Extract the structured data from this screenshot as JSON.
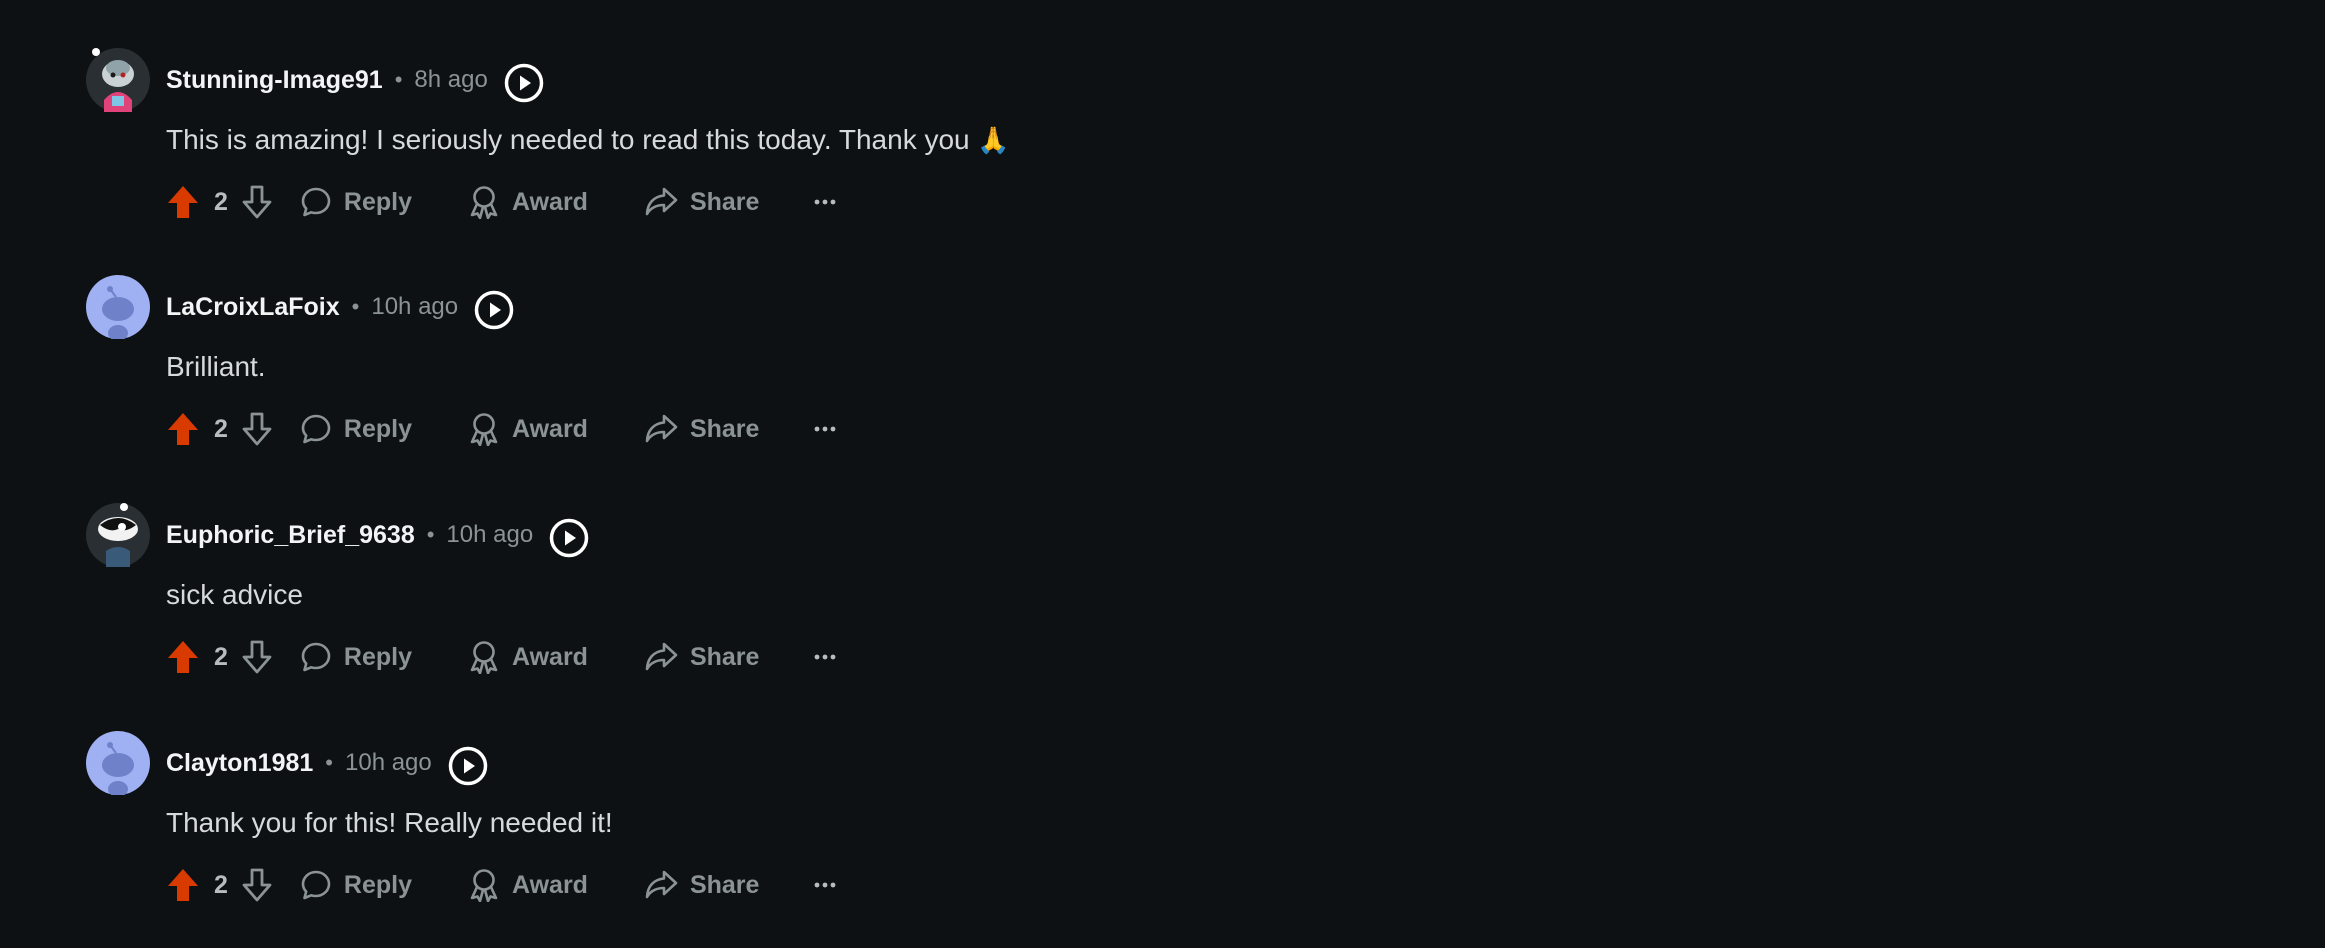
{
  "comments": [
    {
      "username": "Stunning-Image91",
      "separator": "•",
      "time": "8h ago",
      "text": "This is amazing! I seriously needed to read this today. Thank you",
      "emoji": "🙏",
      "score": "2",
      "reply_label": "Reply",
      "award_label": "Award",
      "share_label": "Share",
      "avatar_icon": "snoo-avatar-custom"
    },
    {
      "username": "LaCroixLaFoix",
      "separator": "•",
      "time": "10h ago",
      "text": "Brilliant.",
      "score": "2",
      "reply_label": "Reply",
      "award_label": "Award",
      "share_label": "Share",
      "avatar_icon": "snoo-avatar-default"
    },
    {
      "username": "Euphoric_Brief_9638",
      "separator": "•",
      "time": "10h ago",
      "text": "sick advice",
      "score": "2",
      "reply_label": "Reply",
      "award_label": "Award",
      "share_label": "Share",
      "avatar_icon": "snoo-avatar-custom"
    },
    {
      "username": "Clayton1981",
      "separator": "•",
      "time": "10h ago",
      "text": "Thank you for this! Really needed it!",
      "score": "2",
      "reply_label": "Reply",
      "award_label": "Award",
      "share_label": "Share",
      "avatar_icon": "snoo-avatar-default"
    }
  ],
  "colors": {
    "background": "#0e1113",
    "upvote": "#d93a00",
    "muted": "#8b9396",
    "username": "#f2f4f5",
    "avatar_default": "#9fb1f2"
  }
}
